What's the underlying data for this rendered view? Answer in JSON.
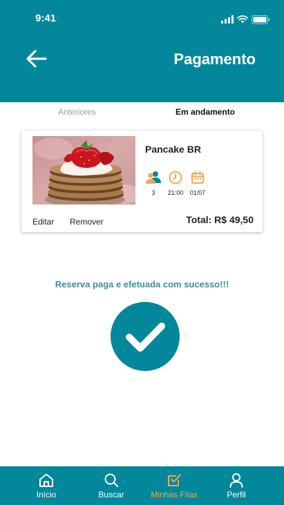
{
  "status_bar": {
    "time": "9:41"
  },
  "header": {
    "title": "Pagamento"
  },
  "tabs": {
    "previous": "Anteriores",
    "current": "Em andamento"
  },
  "reservation": {
    "name": "Pancake BR",
    "people": "3",
    "time": "21:00",
    "date": "01/07",
    "edit_label": "Editar",
    "remove_label": "Remover",
    "total": "Total: R$ 49,50"
  },
  "success_message": "Reserva paga e efetuada com sucesso!!!",
  "bottom_nav": {
    "items": [
      {
        "label": "Início",
        "icon": "home-icon"
      },
      {
        "label": "Buscar",
        "icon": "search-icon"
      },
      {
        "label": "Minhas Filas",
        "icon": "checkbox-icon",
        "active": true
      },
      {
        "label": "Perfil",
        "icon": "user-icon"
      }
    ]
  },
  "colors": {
    "primary": "#03879a",
    "accent": "#f0a857",
    "success_text": "#3f8c94"
  }
}
